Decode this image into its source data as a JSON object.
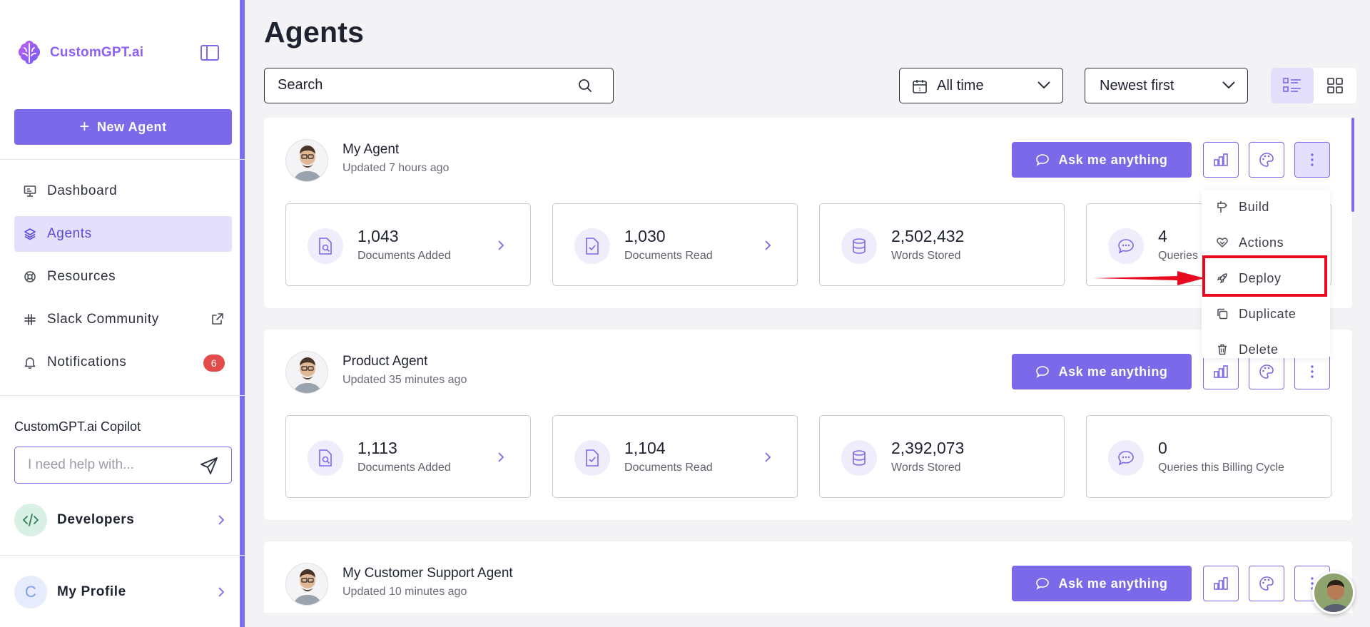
{
  "brand": {
    "name": "CustomGPT.ai"
  },
  "sidebar": {
    "new_agent_label": "New Agent",
    "items": [
      {
        "label": "Dashboard",
        "icon": "dashboard-icon"
      },
      {
        "label": "Agents",
        "icon": "layers-icon",
        "active": true
      },
      {
        "label": "Resources",
        "icon": "lifebuoy-icon"
      },
      {
        "label": "Slack Community",
        "icon": "slack-icon"
      },
      {
        "label": "Notifications",
        "icon": "bell-icon",
        "badge": "6"
      }
    ],
    "copilot": {
      "title": "CustomGPT.ai Copilot",
      "placeholder": "I need help with..."
    },
    "developers_label": "Developers",
    "profile": {
      "initial": "C",
      "label": "My Profile"
    }
  },
  "main": {
    "title": "Agents",
    "search_placeholder": "Search",
    "time_filter": "All time",
    "sort": "Newest first",
    "ask_label": "Ask me anything",
    "agents": [
      {
        "name": "My Agent",
        "updated": "Updated 7 hours ago",
        "stats": [
          {
            "value": "1,043",
            "label": "Documents Added"
          },
          {
            "value": "1,030",
            "label": "Documents Read"
          },
          {
            "value": "2,502,432",
            "label": "Words Stored"
          },
          {
            "value": "4",
            "label": "Queries"
          }
        ]
      },
      {
        "name": "Product Agent",
        "updated": "Updated 35 minutes ago",
        "stats": [
          {
            "value": "1,113",
            "label": "Documents Added"
          },
          {
            "value": "1,104",
            "label": "Documents Read"
          },
          {
            "value": "2,392,073",
            "label": "Words Stored"
          },
          {
            "value": "0",
            "label": "Queries this Billing Cycle"
          }
        ]
      },
      {
        "name": "My Customer Support Agent",
        "updated": "Updated 10 minutes ago"
      }
    ]
  },
  "menu": {
    "items": [
      {
        "label": "Build",
        "icon": "build-icon"
      },
      {
        "label": "Actions",
        "icon": "handshake-icon"
      },
      {
        "label": "Deploy",
        "icon": "rocket-icon"
      },
      {
        "label": "Duplicate",
        "icon": "copy-icon"
      },
      {
        "label": "Delete",
        "icon": "trash-icon"
      }
    ]
  },
  "colors": {
    "accent": "#7a69e8",
    "highlight": "#e8091e",
    "badge": "#e34b4b"
  }
}
